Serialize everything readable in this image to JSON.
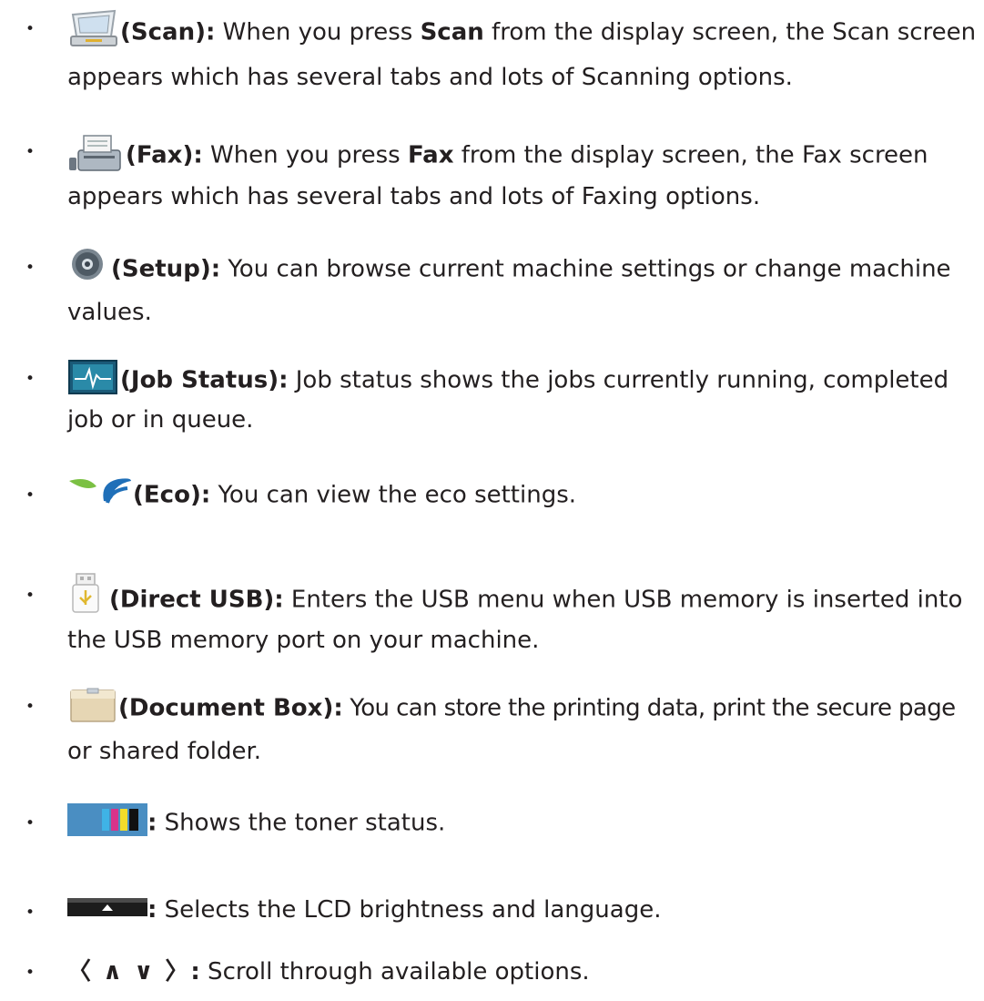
{
  "items": [
    {
      "open": "(",
      "label": "Scan",
      "close": "):",
      "text_a": " When you press ",
      "bold_b": "Scan",
      "text_b": " from the display screen, the Scan screen",
      "line2": "appears which has several tabs and lots of Scanning options.",
      "icon": "scanner-icon"
    },
    {
      "open": "(",
      "label": "Fax",
      "close": "):",
      "text_a": " When you press ",
      "bold_b": "Fax",
      "text_b": " from the display screen, the Fax screen",
      "line2": "appears which has several tabs and lots of Faxing options.",
      "icon": "fax-icon"
    },
    {
      "open": "(",
      "label": "Setup",
      "close": "):",
      "text_a": " You can browse current machine settings or change machine",
      "line2": "values.",
      "icon": "gear-icon"
    },
    {
      "open": "(",
      "label": "Job Status",
      "close": "):",
      "text_a": " Job status shows the jobs currently running, completed",
      "line2": "job or in queue.",
      "icon": "job-status-icon"
    },
    {
      "open": "(",
      "label": "Eco",
      "close": "):",
      "text_a": " You can view the eco settings.",
      "icon": "eco-leaf-icon"
    },
    {
      "open": "(",
      "label": "Direct USB",
      "close": "):",
      "text_a": " Enters the USB menu when USB memory is inserted into",
      "line2": "the USB memory port on your machine.",
      "icon": "usb-icon"
    },
    {
      "open": "(",
      "label": "Document Box",
      "close": "):",
      "text_a": " You can store the printing data, print the secure page",
      "line2": "or shared folder.",
      "icon": "folder-icon"
    },
    {
      "close": ":",
      "text_a": " Shows the toner status.",
      "icon": "toner-status-icon"
    },
    {
      "close": ":",
      "text_a": " Selects the LCD brightness and language.",
      "icon": "brightness-tab-icon"
    },
    {
      "arrows": "〈 ∧ ∨ 〉",
      "close": ":",
      "text_a": " Scroll through available options.",
      "icon": "scroll-arrows-icon"
    }
  ],
  "bullet": "•"
}
